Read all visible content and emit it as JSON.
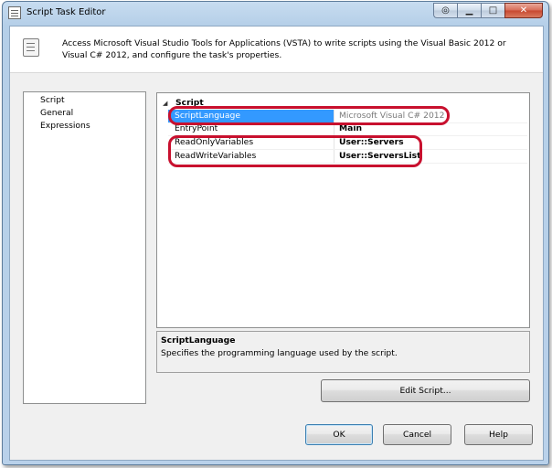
{
  "window": {
    "title": "Script Task Editor"
  },
  "caption_buttons": [
    {
      "name": "help-icon",
      "glyph": "◎"
    },
    {
      "name": "minimize-icon",
      "glyph": "▁"
    },
    {
      "name": "maximize-icon",
      "glyph": "□"
    },
    {
      "name": "close-icon",
      "glyph": "✕"
    }
  ],
  "header": {
    "description": "Access Microsoft Visual Studio Tools for Applications (VSTA) to write scripts using the Visual Basic 2012 or Visual C# 2012, and configure the task's properties."
  },
  "nav": {
    "items": [
      "Script",
      "General",
      "Expressions"
    ]
  },
  "property_grid": {
    "category": "Script",
    "rows": [
      {
        "name": "ScriptLanguage",
        "value": "Microsoft Visual C# 2012"
      },
      {
        "name": "EntryPoint",
        "value": "Main"
      },
      {
        "name": "ReadOnlyVariables",
        "value": "User::Servers"
      },
      {
        "name": "ReadWriteVariables",
        "value": "User::ServersList"
      }
    ]
  },
  "description_panel": {
    "title": "ScriptLanguage",
    "text": "Specifies the programming language used by the script."
  },
  "buttons": {
    "edit_script": "Edit Script...",
    "ok": "OK",
    "cancel": "Cancel",
    "help": "Help"
  },
  "colors": {
    "selection": "#3399ff",
    "annotation": "#c8102e"
  }
}
